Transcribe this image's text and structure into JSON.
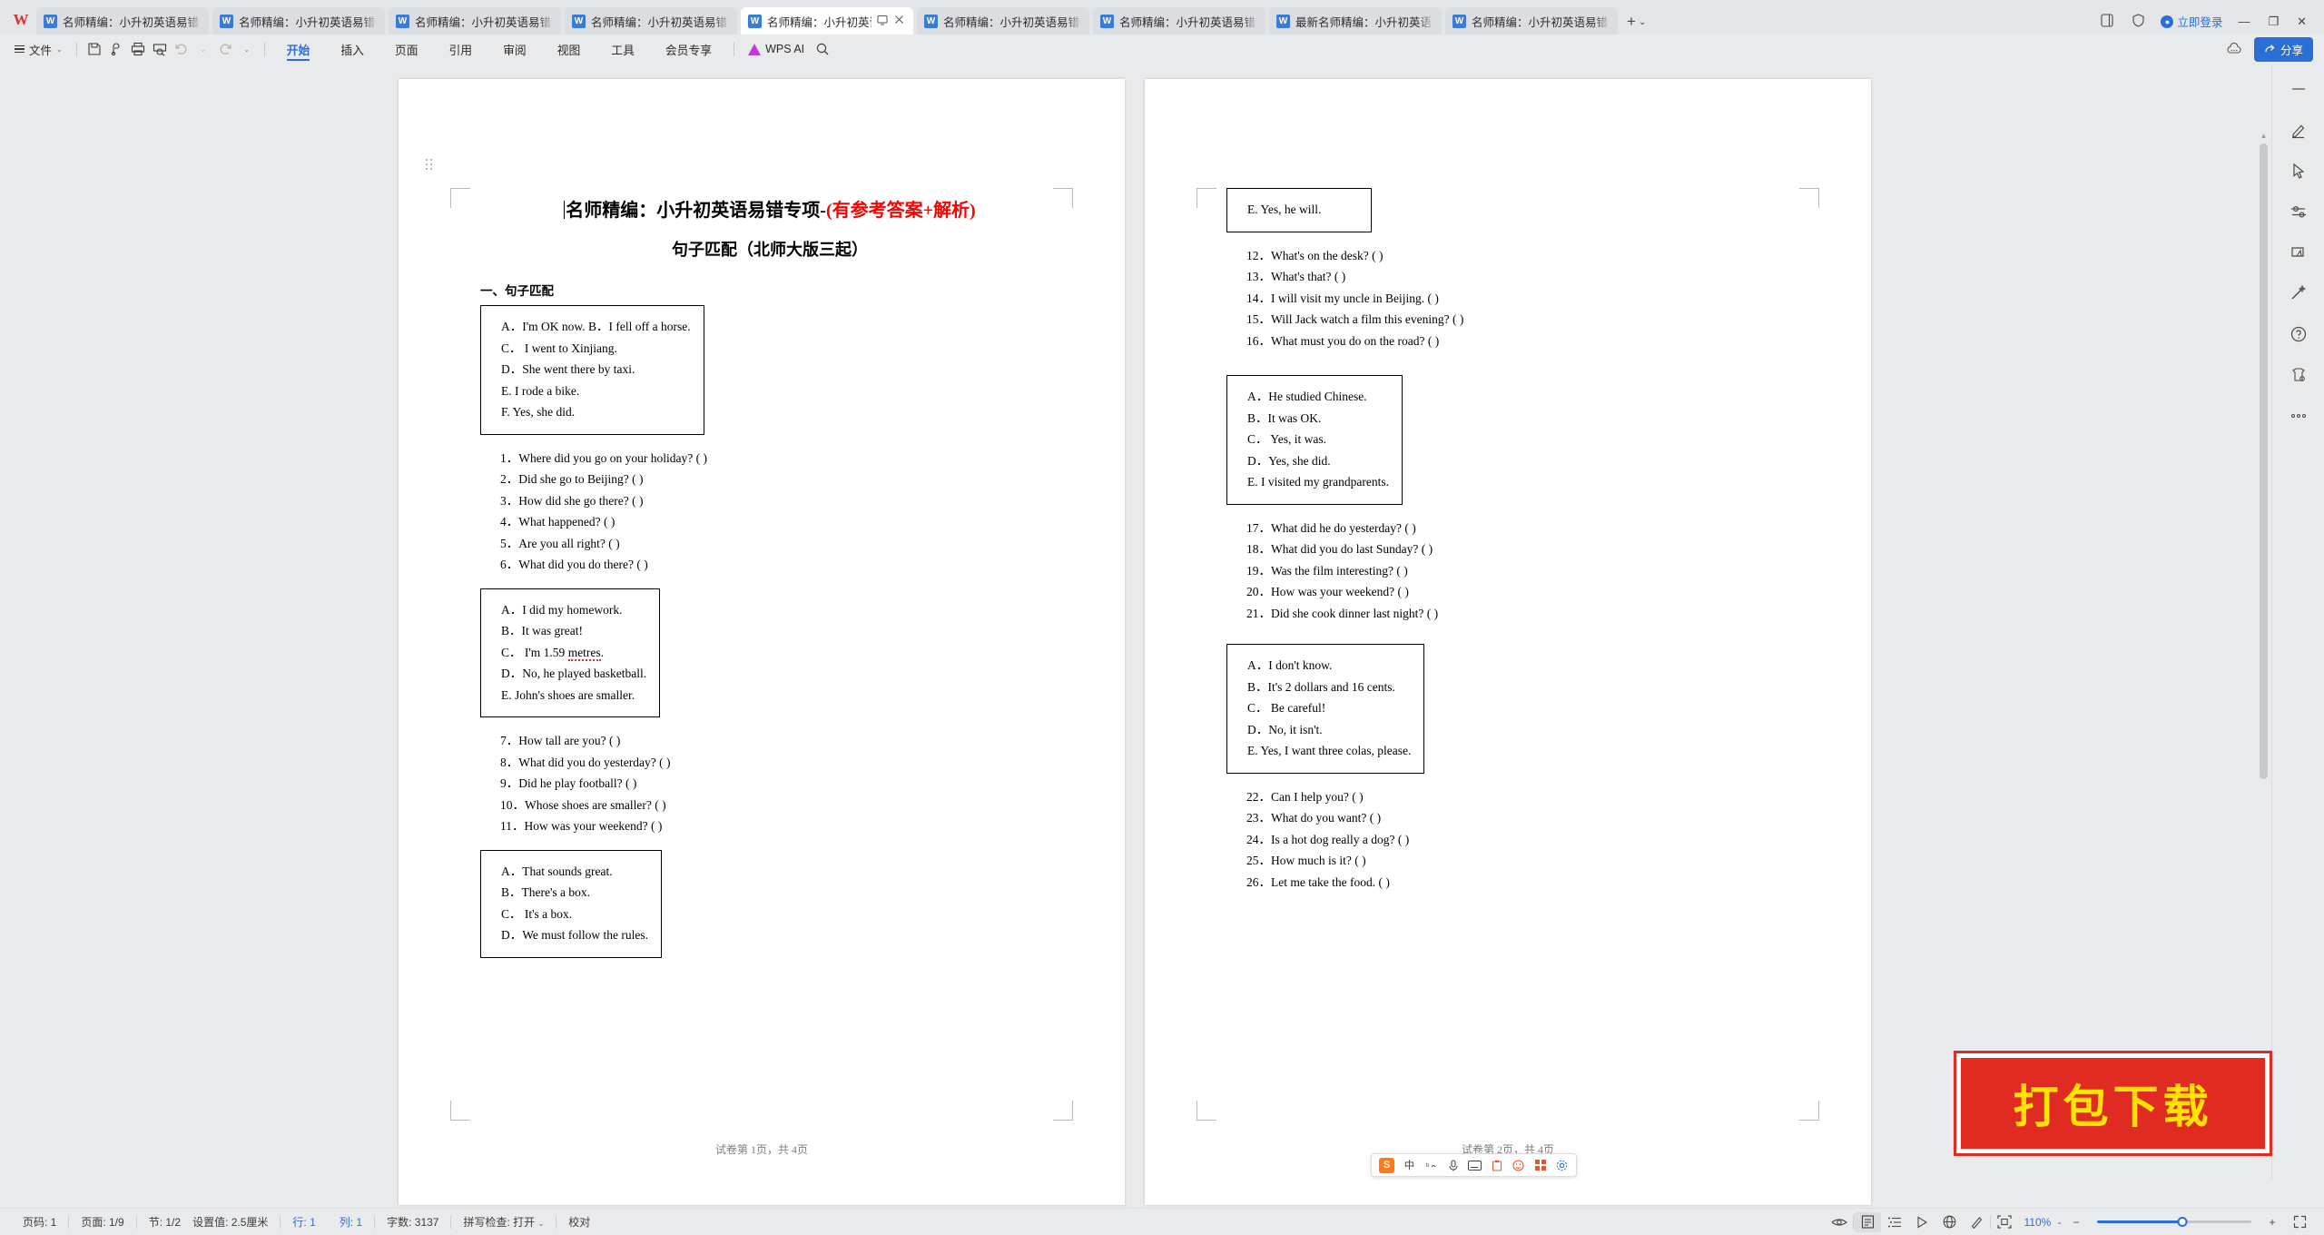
{
  "app": {
    "logo": "W"
  },
  "tabs": [
    {
      "label": "名师精编：小升初英语易错专项",
      "icon": "word-doc-icon",
      "active": false
    },
    {
      "label": "名师精编：小升初英语易错专项",
      "icon": "word-doc-icon",
      "active": false
    },
    {
      "label": "名师精编：小升初英语易错专项",
      "icon": "word-doc-icon",
      "active": false
    },
    {
      "label": "名师精编：小升初英语易错专项",
      "icon": "word-doc-icon",
      "active": false
    },
    {
      "label": "名师精编：小升初英语易",
      "icon": "word-doc-icon",
      "active": true
    },
    {
      "label": "名师精编：小升初英语易错专项",
      "icon": "word-doc-icon",
      "active": false
    },
    {
      "label": "名师精编：小升初英语易错专项",
      "icon": "word-doc-icon",
      "active": false
    },
    {
      "label": "最新名师精编：小升初英语易错",
      "icon": "word-doc-icon",
      "active": false
    },
    {
      "label": "名师精编：小升初英语易错专项",
      "icon": "word-doc-icon",
      "active": false
    }
  ],
  "titlebar": {
    "new_tab": "+",
    "login": "立即登录",
    "minimize": "—",
    "restore": "❐",
    "close": "✕"
  },
  "ribbon": {
    "file_menu": "文件",
    "quick_icons": [
      "save-icon",
      "save-as-cloud-icon",
      "print-icon",
      "print-preview-icon",
      "undo-icon",
      "redo-icon",
      "customize-icon"
    ],
    "tabs": [
      {
        "label": "开始",
        "active": true
      },
      {
        "label": "插入",
        "active": false
      },
      {
        "label": "页面",
        "active": false
      },
      {
        "label": "引用",
        "active": false
      },
      {
        "label": "审阅",
        "active": false
      },
      {
        "label": "视图",
        "active": false
      },
      {
        "label": "工具",
        "active": false
      },
      {
        "label": "会员专享",
        "active": false
      }
    ],
    "ai_label": "WPS AI",
    "search_icon": "search-icon",
    "more_icon": "more-cloud-icon",
    "share_label": "分享"
  },
  "document": {
    "title_black": "名师精编：小升初英语易错专项-",
    "title_red": "(有参考答案+解析)",
    "subtitle": "句子匹配（北师大版三起）",
    "section_heading": "一、句子匹配",
    "page1": {
      "box1": [
        "A．I'm OK now. B．I fell off a horse.",
        "C．  I went to Xinjiang.",
        "D．She went there by taxi.",
        "E. I rode a bike.",
        "F. Yes, she did."
      ],
      "questions1": [
        "1．Where did you go on your holiday? (            )",
        "2．Did she go to Beijing? (          )",
        "3．How did she go there? (          )",
        "4．What happened? (          )",
        "5．Are you all right? (          )",
        "6．What did you do there? (          )"
      ],
      "box2": [
        "A．I did my homework.",
        "B．It was great!",
        "C．  I'm 1.59 metres.",
        "D．No, he played basketball.",
        "E. John's shoes are smaller."
      ],
      "questions2": [
        "7．How tall are you? (        )",
        "8．What did you do yesterday? (          )",
        "9．Did he play football? (        )",
        "10．Whose shoes are smaller? (         )",
        "11．How was your weekend? (          )"
      ],
      "box3": [
        "A．That sounds great.",
        "B．There's a box.",
        "C．  It's a box.",
        "D．We must follow the rules."
      ],
      "footer": "试卷第 1页，共 4页"
    },
    "page2": {
      "box1": [
        "E. Yes, he will."
      ],
      "questions1": [
        "12．What's on the desk? (        )",
        "13．What's that? (        )",
        "14．I will visit my uncle in Beijing. (        )",
        "15．Will Jack watch a film this evening? (         )",
        "16．What must you do on the road? (        )"
      ],
      "box2": [
        "A．He studied Chinese.",
        "B．It was OK.",
        "C．  Yes, it was.",
        "D．Yes, she did.",
        "E. I visited my grandparents."
      ],
      "questions2": [
        "17．What did he do yesterday? (        )",
        "18．What did you do last Sunday? (        )",
        "19．Was the film interesting? (        )",
        "20．How was your weekend? (        )",
        "21．Did she cook dinner last night? (        )"
      ],
      "box3": [
        "A．I don't know.",
        "B．It's 2 dollars and 16 cents.",
        "C．  Be careful!",
        "D．No, it isn't.",
        "E. Yes, I want three colas, please."
      ],
      "questions3": [
        "22．Can I help you? (        )",
        "23．What do you want? (        )",
        "24．Is a hot dog really a dog? (        )",
        "25．How much is it? (        )",
        "26．Let me take the food. (        )"
      ],
      "footer": "试卷第 2页，共 4页"
    }
  },
  "ime": {
    "engine": "S",
    "mode": "中",
    "items": [
      "pinyin-icon",
      "voice-icon",
      "keyboard-icon",
      "clipboard-icon",
      "emoji-icon",
      "apps-icon",
      "settings-icon"
    ]
  },
  "watermark": {
    "text": "打包下载"
  },
  "rail": {
    "items": [
      "collapse-icon",
      "pen-icon",
      "cursor-icon",
      "adjust-icon",
      "highlight-icon",
      "magic-icon",
      "help-icon",
      "template-icon",
      "more-icon"
    ]
  },
  "status": {
    "page_no_label": "页码: 1",
    "pages_label": "页面: 1/9",
    "section_label": "节: 1/2",
    "margin_label": "设置值: 2.5厘米",
    "row_label": "行: 1",
    "col_label": "列: 1",
    "words_label": "字数: 3137",
    "spellcheck_label": "拼写检查: 打开",
    "proof_label": "校对",
    "view_icons": [
      "eye-icon",
      "page-view-icon",
      "outline-view-icon",
      "play-icon",
      "web-view-icon",
      "pen-view-icon",
      "fit-icon"
    ],
    "zoom_value": "110%",
    "zoom_minus": "−",
    "zoom_plus": "+",
    "fullscreen_icon": "fullscreen-icon"
  }
}
